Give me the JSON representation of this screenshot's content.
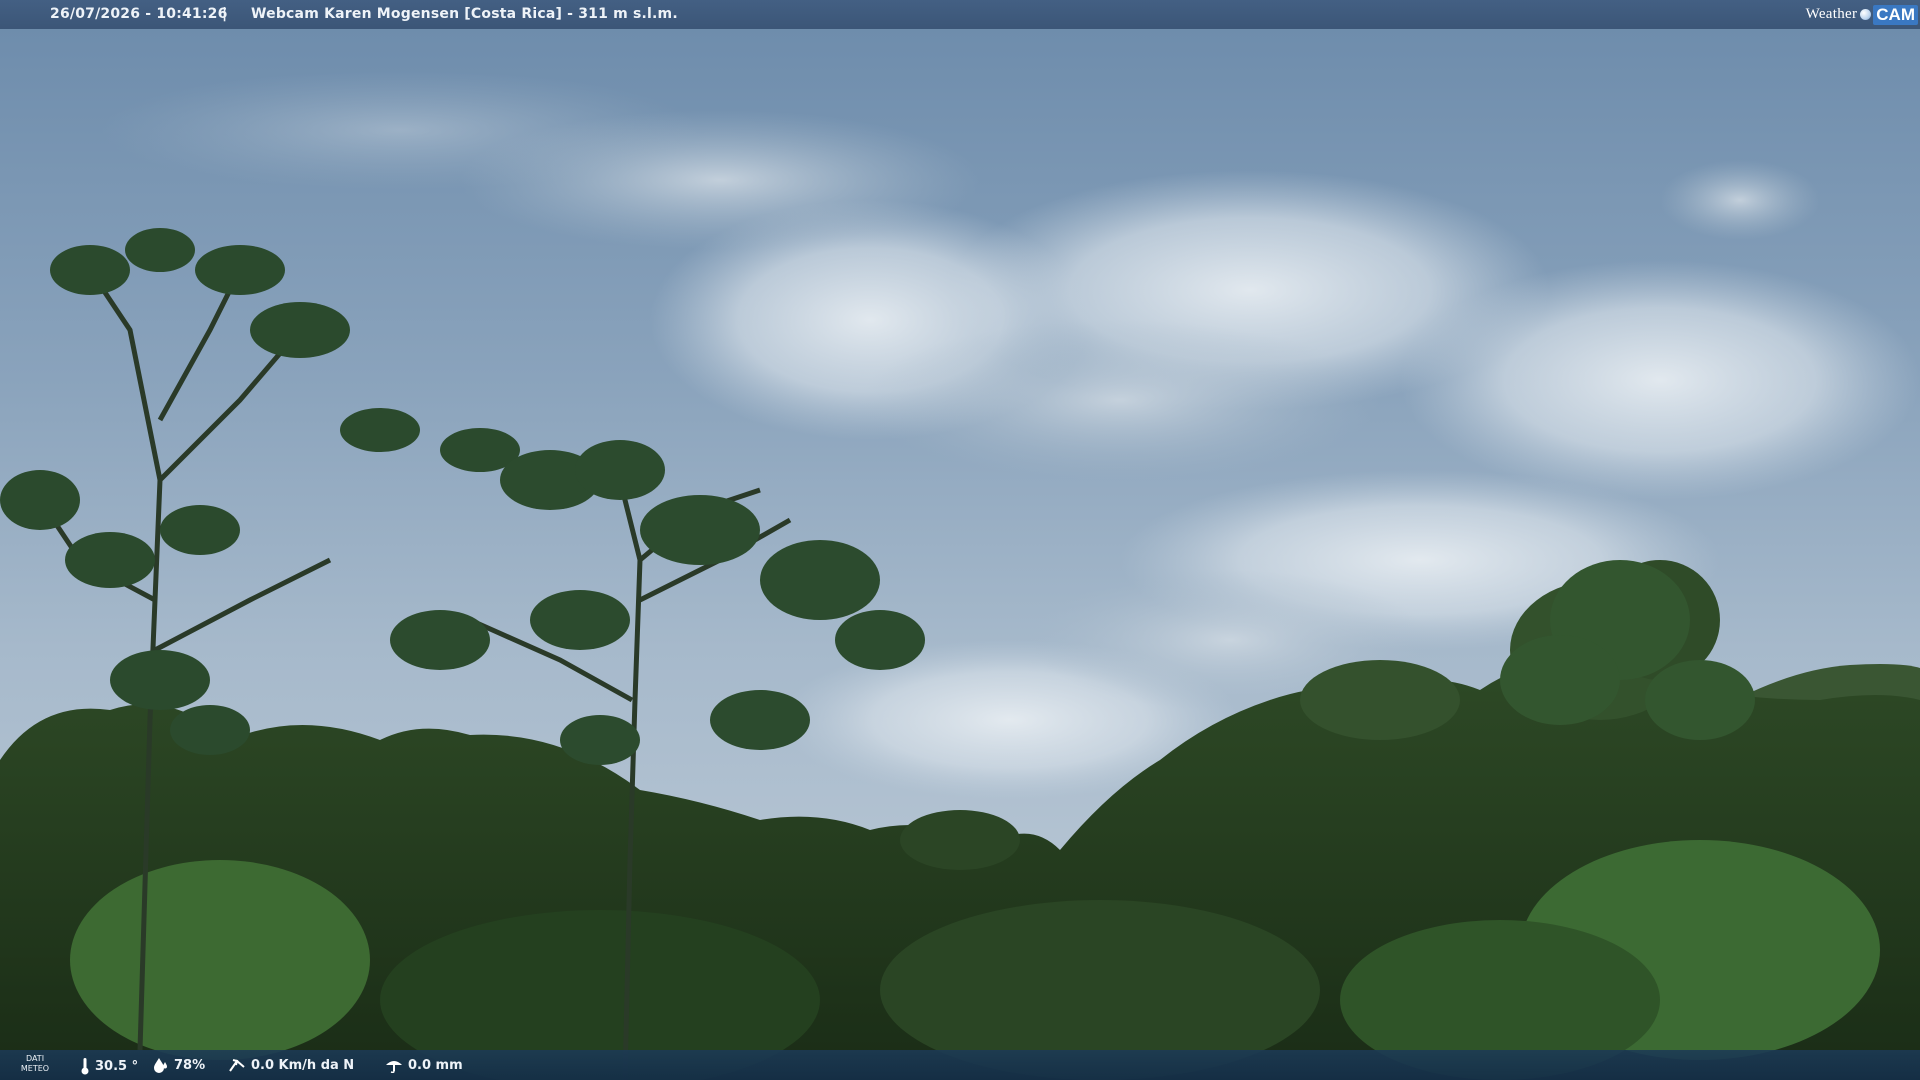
{
  "header": {
    "timestamp": "26/07/2026 - 10:41:26",
    "separator": "|",
    "camera_title": "Webcam Karen Mogensen [Costa Rica] - 311 m s.l.m."
  },
  "logo": {
    "brand_word": "Weather",
    "brand_suffix": "CAM",
    "accent_color": "#3a78c2"
  },
  "meteo": {
    "label": "DATI METEO",
    "temperature": "30.5 °",
    "humidity": "78%",
    "wind": "0.0 Km/h da N",
    "rain": "0.0 mm",
    "icons": [
      "thermometer-icon",
      "humidity-drop-icon",
      "wind-icon",
      "rain-gauge-icon"
    ]
  },
  "scene": {
    "description_colors": {
      "sky_top": "#6f8eab",
      "sky_mid": "#a9bccd",
      "cloud": "#dfe6ec",
      "foliage_dark": "#1c3018",
      "foliage_light": "#4f7a3a"
    }
  }
}
